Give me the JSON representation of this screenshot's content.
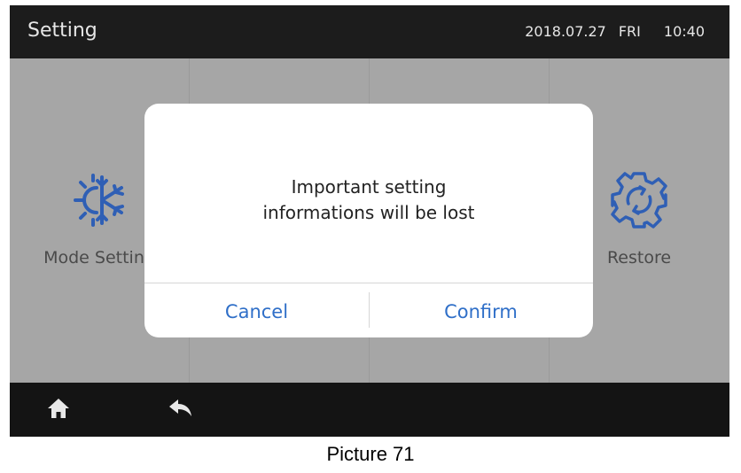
{
  "header": {
    "title": "Setting",
    "date": "2018.07.27",
    "weekday": "FRI",
    "time": "10:40"
  },
  "tiles": [
    {
      "label": "Mode Setting",
      "icon": "snowflake-sun-icon"
    },
    {
      "label": "",
      "icon": ""
    },
    {
      "label": "",
      "icon": ""
    },
    {
      "label": "Restore",
      "icon": "gear-restore-icon"
    }
  ],
  "dialog": {
    "message_line1": "Important setting",
    "message_line2": "informations will be lost",
    "cancel_label": "Cancel",
    "confirm_label": "Confirm"
  },
  "nav": {
    "home_icon": "home-icon",
    "back_icon": "back-icon"
  },
  "caption": "Picture 71",
  "colors": {
    "accent": "#2f6fc8",
    "icon_blue": "#2f5fb5",
    "bar": "#1c1c1c",
    "content_bg": "#a6a6a6"
  }
}
